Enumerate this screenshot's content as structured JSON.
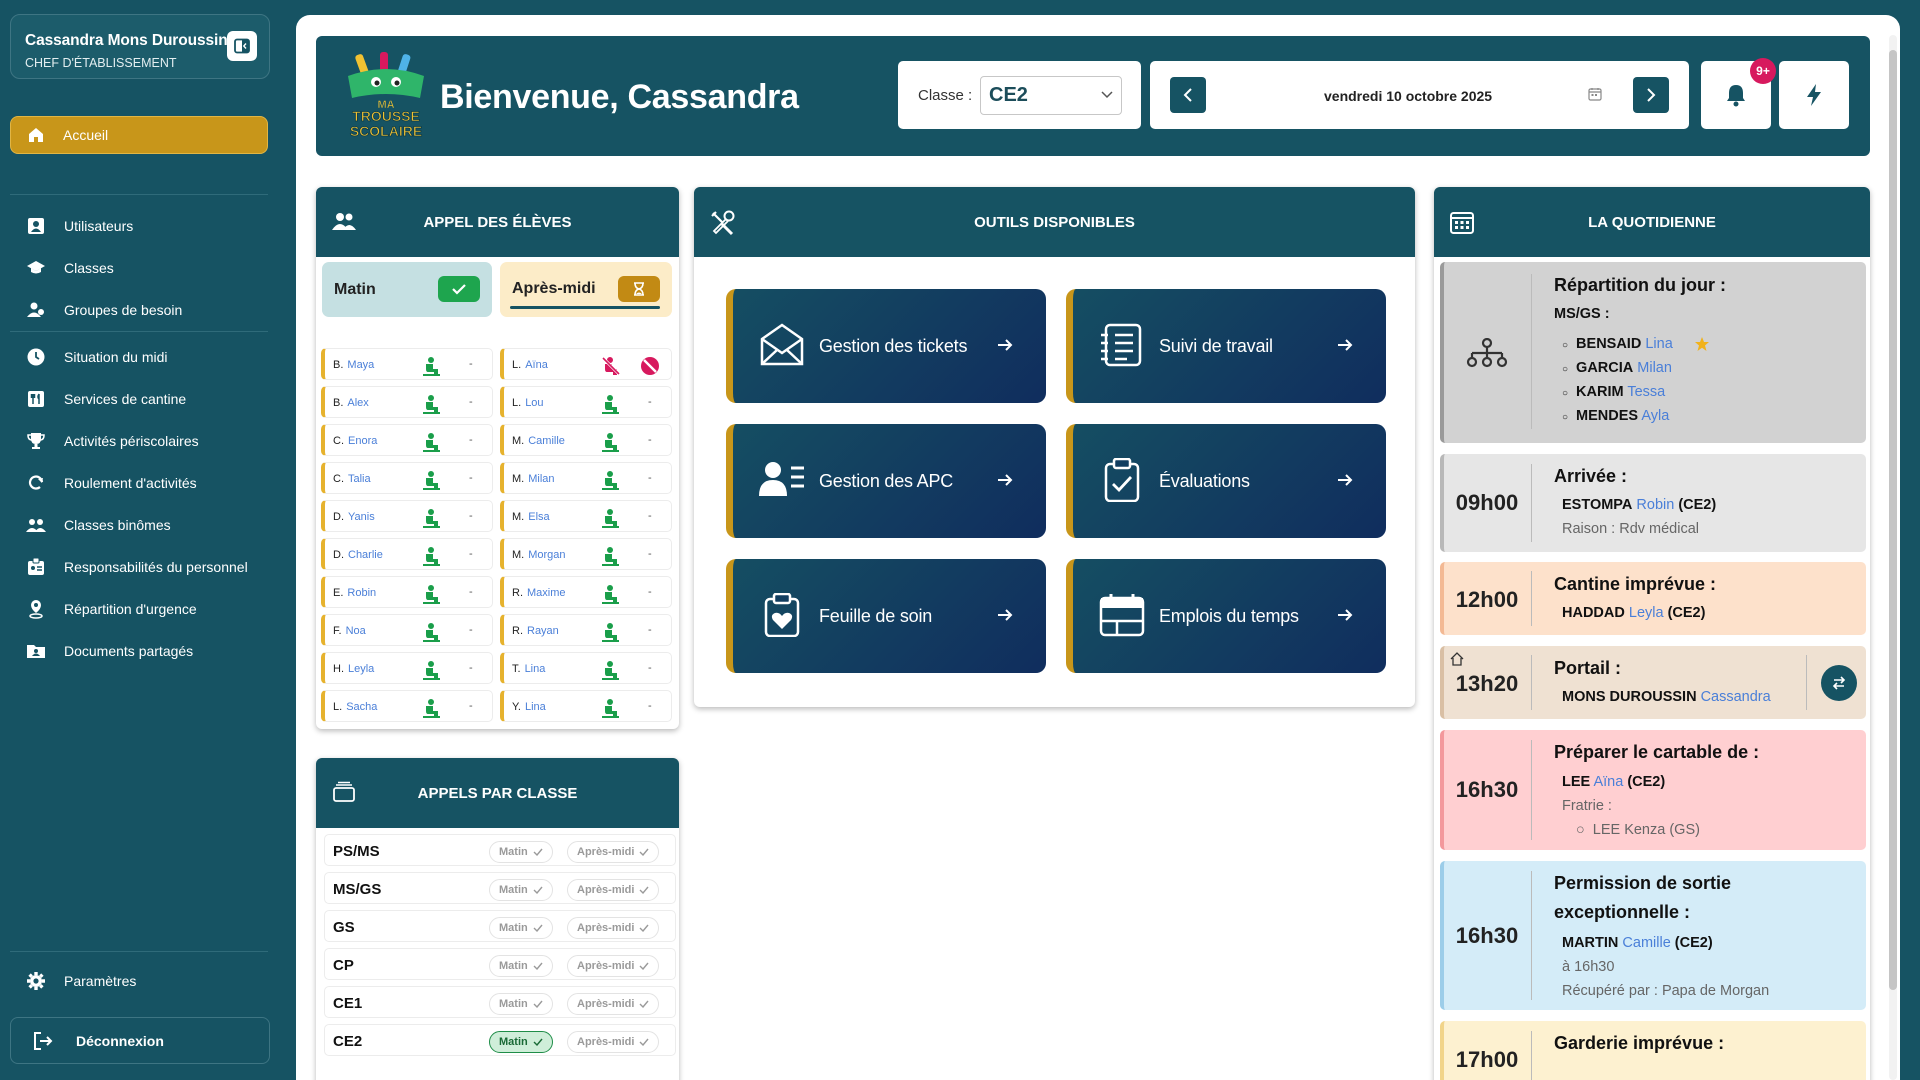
{
  "user": {
    "name": "Cassandra Mons Duroussin",
    "role": "CHEF D'ÉTABLISSEMENT"
  },
  "nav": {
    "home": "Accueil",
    "items": [
      "Utilisateurs",
      "Classes",
      "Groupes de besoin",
      "Situation du midi",
      "Services de cantine",
      "Activités périscolaires",
      "Roulement d'activités",
      "Classes binômes",
      "Responsabilités du personnel",
      "Répartition d'urgence",
      "Documents partagés"
    ],
    "settings": "Paramètres",
    "logout": "Déconnexion"
  },
  "header": {
    "logo_text": "MA TROUSSE SCOLAIRE",
    "welcome": "Bienvenue, Cassandra",
    "class_label": "Classe :",
    "class_value": "CE2",
    "date": "vendredi 10 octobre 2025",
    "notif_badge": "9+"
  },
  "appel": {
    "title": "APPEL DES ÉLÈVES",
    "tab_matin": "Matin",
    "tab_apm": "Après-midi",
    "left": [
      {
        "i": "B.",
        "n": "Maya",
        "mark": "-"
      },
      {
        "i": "B.",
        "n": "Alex",
        "mark": "-"
      },
      {
        "i": "C.",
        "n": "Enora",
        "mark": "-"
      },
      {
        "i": "C.",
        "n": "Talia",
        "mark": "-"
      },
      {
        "i": "D.",
        "n": "Yanis",
        "mark": "-"
      },
      {
        "i": "D.",
        "n": "Charlie",
        "mark": "-"
      },
      {
        "i": "E.",
        "n": "Robin",
        "mark": "-"
      },
      {
        "i": "F.",
        "n": "Noa",
        "mark": "-"
      },
      {
        "i": "H.",
        "n": "Leyla",
        "mark": "-"
      },
      {
        "i": "L.",
        "n": "Sacha",
        "mark": "-"
      }
    ],
    "right": [
      {
        "i": "L.",
        "n": "Aïna",
        "mark": ""
      },
      {
        "i": "L.",
        "n": "Lou",
        "mark": "-"
      },
      {
        "i": "M.",
        "n": "Camille",
        "mark": "-"
      },
      {
        "i": "M.",
        "n": "Milan",
        "mark": "-"
      },
      {
        "i": "M.",
        "n": "Elsa",
        "mark": "-"
      },
      {
        "i": "M.",
        "n": "Morgan",
        "mark": "-"
      },
      {
        "i": "R.",
        "n": "Maxime",
        "mark": "-"
      },
      {
        "i": "R.",
        "n": "Rayan",
        "mark": "-"
      },
      {
        "i": "T.",
        "n": "Lina",
        "mark": "-"
      },
      {
        "i": "Y.",
        "n": "Lina",
        "mark": "-"
      }
    ]
  },
  "appels_classe": {
    "title": "APPELS PAR CLASSE",
    "matin": "Matin",
    "apm": "Après-midi",
    "classes": [
      "PS/MS",
      "MS/GS",
      "GS",
      "CP",
      "CE1",
      "CE2"
    ]
  },
  "outils": {
    "title": "OUTILS DISPONIBLES",
    "items": [
      "Gestion des tickets",
      "Suivi de travail",
      "Gestion des APC",
      "Évaluations",
      "Feuille de soin",
      "Emplois du temps"
    ]
  },
  "quotidienne": {
    "title": "LA QUOTIDIENNE",
    "repartition": {
      "title": "Répartition du jour :",
      "group": "MS/GS :",
      "items": [
        {
          "last": "BENSAID",
          "first": "Lina"
        },
        {
          "last": "GARCIA",
          "first": "Milan"
        },
        {
          "last": "KARIM",
          "first": "Tessa"
        },
        {
          "last": "MENDES",
          "first": "Ayla"
        }
      ]
    },
    "arrivee": {
      "time": "09h00",
      "title": "Arrivée :",
      "last": "ESTOMPA",
      "first": "Robin",
      "cls": "(CE2)",
      "note": "Raison : Rdv médical"
    },
    "cantine": {
      "time": "12h00",
      "title": "Cantine imprévue :",
      "last": "HADDAD",
      "first": "Leyla",
      "cls": "(CE2)"
    },
    "portail": {
      "time": "13h20",
      "title": "Portail :",
      "last": "MONS DUROUSSIN",
      "first": "Cassandra"
    },
    "cartable": {
      "time": "16h30",
      "title": "Préparer le cartable de :",
      "last": "LEE",
      "first": "Aïna",
      "cls": "(CE2)",
      "fratrie": "Fratrie :",
      "sibling": "LEE Kenza (GS)"
    },
    "permission": {
      "time": "16h30",
      "title1": "Permission de sortie",
      "title2": "exceptionnelle :",
      "last": "MARTIN",
      "first": "Camille",
      "cls": "(CE2)",
      "at": "à 16h30",
      "by": "Récupéré par : Papa de Morgan"
    },
    "garderie": {
      "time": "17h00",
      "title": "Garderie imprévue :"
    }
  },
  "colors": {
    "primary": "#165363",
    "accent": "#c8961a",
    "present": "#1ea54e",
    "absent": "#d7195e",
    "link": "#4a7fd8"
  }
}
